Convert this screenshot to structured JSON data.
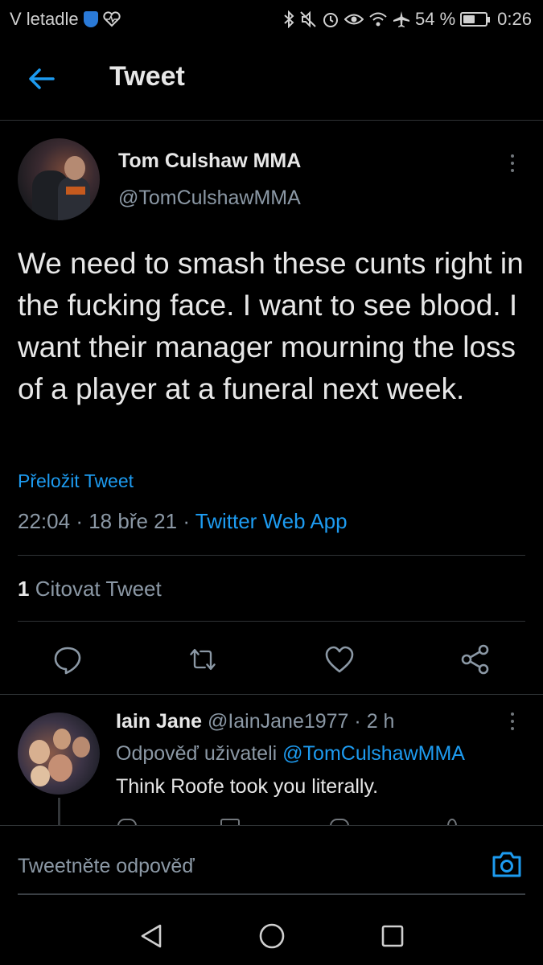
{
  "status_bar": {
    "carrier": "V letadle",
    "battery": "54 %",
    "battery_level": 0.54,
    "time": "0:26",
    "icons": [
      "shield-icon",
      "heart-monitor-icon",
      "bluetooth-icon",
      "mute-icon",
      "alarm-icon",
      "eye-icon",
      "wifi-icon",
      "airplane-icon",
      "battery-icon"
    ]
  },
  "header": {
    "title": "Tweet",
    "back_icon": "arrow-left-icon"
  },
  "tweet": {
    "author_name": "Tom Culshaw MMA",
    "author_handle": "@TomCulshawMMA",
    "text": "We need to smash these cunts right in the fucking face. I want to see blood. I want their manager mourning the loss of a player at a funeral next week.",
    "translate_label": "Přeložit Tweet",
    "time": "22:04",
    "date": "18 bře 21",
    "separator": "·",
    "source": "Twitter Web App",
    "quote_count": "1",
    "quote_label": "Citovat Tweet",
    "accent": "#1d9bf0"
  },
  "actions": [
    "reply-icon",
    "retweet-icon",
    "like-icon",
    "share-icon"
  ],
  "reply": {
    "author_name": "Iain Jane",
    "author_handle": "@IainJane1977",
    "time": "2 h",
    "reply_to_prefix": "Odpověď uživateli",
    "reply_to_handle": "@TomCulshawMMA",
    "text": "Think Roofe took you literally."
  },
  "compose": {
    "placeholder": "Tweetněte odpověď",
    "camera_icon": "camera-icon"
  },
  "nav": [
    "nav-back-icon",
    "nav-home-icon",
    "nav-recent-icon"
  ]
}
